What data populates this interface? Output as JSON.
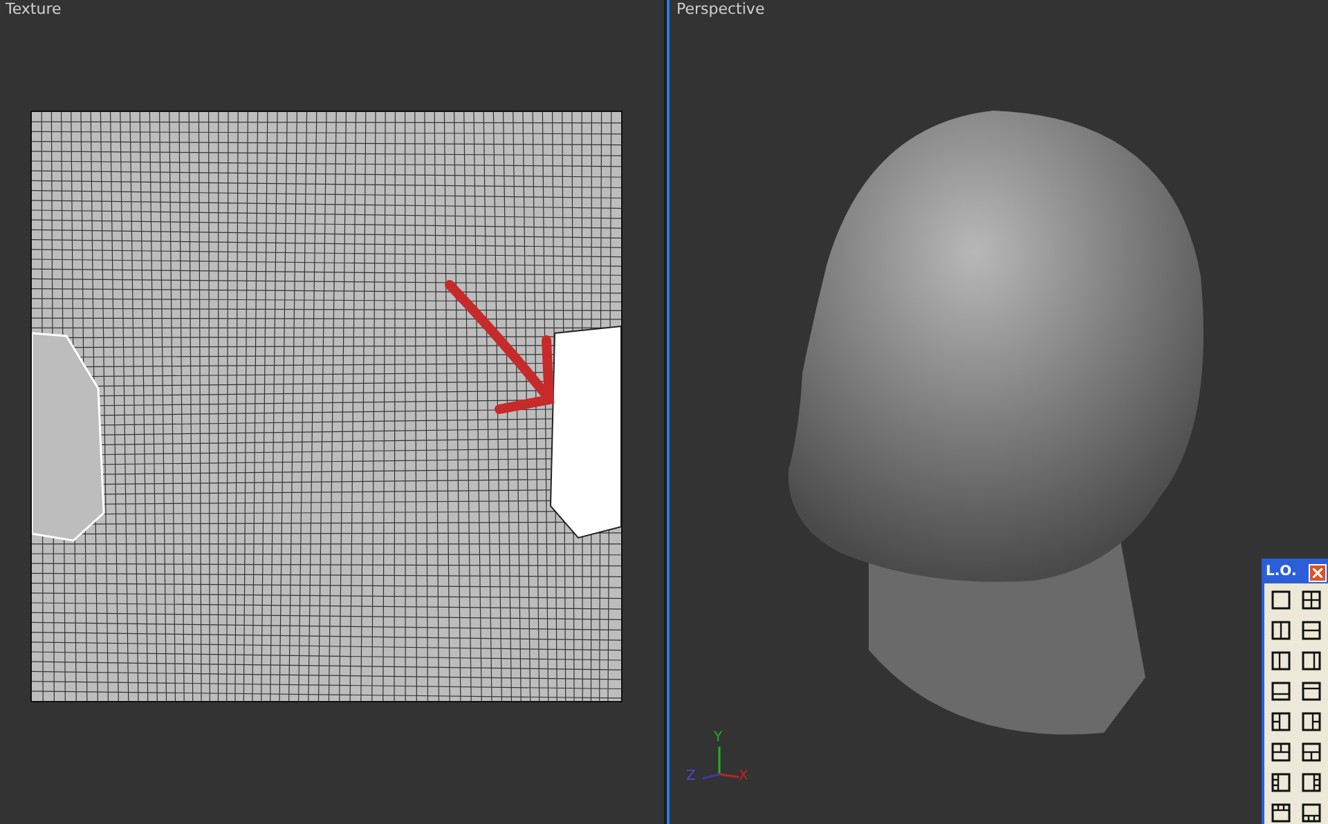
{
  "viewports": [
    {
      "kind": "uv",
      "label": "Texture"
    },
    {
      "kind": "perspective",
      "label": "Perspective",
      "axis": {
        "x": "X",
        "y": "Y",
        "z": "Z"
      }
    }
  ],
  "layout_panel": {
    "title": "L.O."
  }
}
